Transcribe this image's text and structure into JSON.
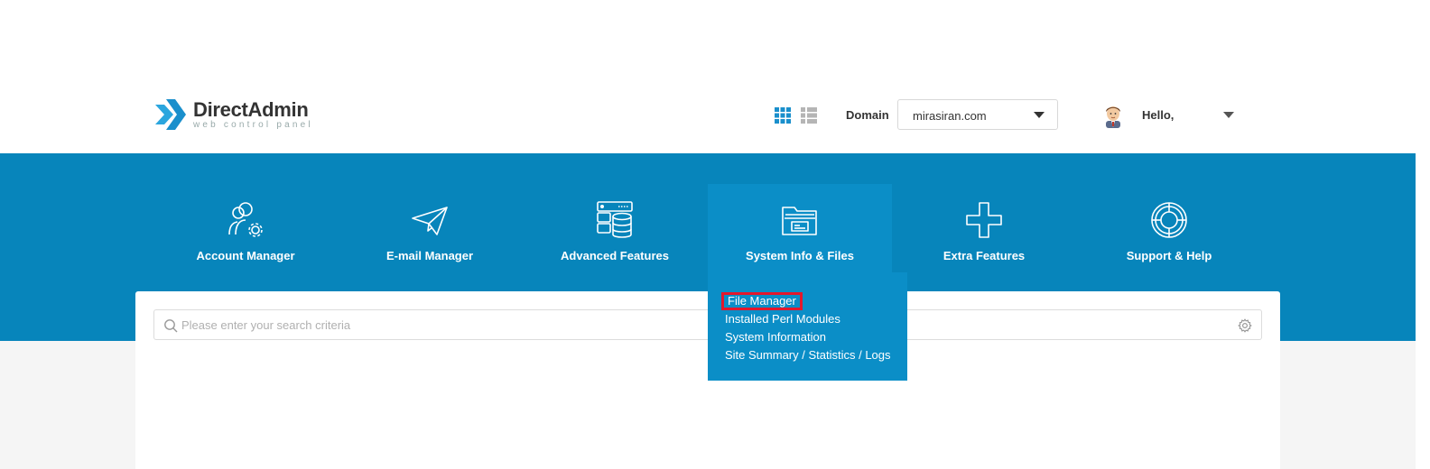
{
  "app": {
    "logo_title": "DirectAdmin",
    "logo_subtitle": "web control panel"
  },
  "header": {
    "domain_label": "Domain",
    "domain_value": "mirasiran.com",
    "greeting": "Hello,",
    "view_modes": [
      "grid-view-icon",
      "list-view-icon"
    ],
    "active_view": "grid"
  },
  "nav": {
    "items": [
      {
        "label": "Account Manager",
        "icon": "account-manager-icon"
      },
      {
        "label": "E-mail Manager",
        "icon": "paper-plane-icon"
      },
      {
        "label": "Advanced Features",
        "icon": "server-database-icon"
      },
      {
        "label": "System Info & Files",
        "icon": "folder-icon",
        "active": true
      },
      {
        "label": "Extra Features",
        "icon": "plus-icon"
      },
      {
        "label": "Support & Help",
        "icon": "lifebuoy-icon"
      }
    ]
  },
  "dropdown": {
    "items": [
      {
        "label": "File Manager",
        "highlighted": true
      },
      {
        "label": "Installed Perl Modules"
      },
      {
        "label": "System Information"
      },
      {
        "label": "Site Summary / Statistics / Logs"
      }
    ]
  },
  "search": {
    "placeholder": "Please enter your search criteria",
    "value": ""
  },
  "colors": {
    "band": "#0785bb",
    "active_tab": "#0b8ec7",
    "highlight_border": "#e3182d",
    "logo_accent": "#1a9ad6"
  }
}
